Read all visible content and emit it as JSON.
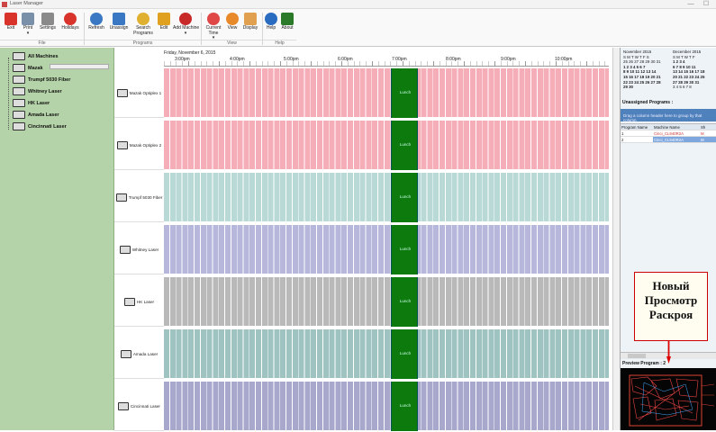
{
  "window": {
    "title": "Laser Manager",
    "controls": [
      "—",
      "☐"
    ]
  },
  "ribbon": {
    "buttons": [
      {
        "id": "exit",
        "label": "Exit",
        "icon": "exit-icon",
        "color": "#d9342b"
      },
      {
        "id": "print",
        "label": "Print",
        "sub": "▾",
        "icon": "printer-icon",
        "color": "#7a8fa8"
      },
      {
        "id": "settings",
        "label": "Settings",
        "icon": "tools-icon",
        "color": "#8a8a8a"
      },
      {
        "id": "holidays",
        "label": "Holidays",
        "icon": "holiday-icon",
        "color": "#d9342b"
      },
      {
        "id": "refresh",
        "label": "Refresh",
        "icon": "refresh-icon",
        "color": "#3a78c4"
      },
      {
        "id": "unassign",
        "label": "Unassign",
        "icon": "undo-arrow-icon",
        "color": "#3a78c4"
      },
      {
        "id": "search",
        "label": "Search Programs",
        "icon": "magnifier-icon",
        "color": "#e0b030"
      },
      {
        "id": "edit",
        "label": "Edit",
        "icon": "pencil-icon",
        "color": "#e0a020"
      },
      {
        "id": "add_machine",
        "label": "Add Machine",
        "sub": "▾",
        "icon": "gear-add-icon",
        "color": "#c82a2a"
      },
      {
        "id": "current_time",
        "label": "Current Time",
        "sub": "▾",
        "icon": "clock-icon",
        "color": "#e04848"
      },
      {
        "id": "view",
        "label": "View",
        "icon": "timer-icon",
        "color": "#e88a2a"
      },
      {
        "id": "display",
        "label": "Display",
        "icon": "tag-icon",
        "color": "#e0a050"
      },
      {
        "id": "help",
        "label": "Help",
        "icon": "help-icon",
        "color": "#2a6cc0"
      },
      {
        "id": "about",
        "label": "About",
        "icon": "back-arrow-icon",
        "color": "#2a7a2a"
      }
    ],
    "groups": [
      "File",
      "Programs",
      "View",
      "Help"
    ]
  },
  "tree": {
    "items": [
      "All Machines",
      "Mazak",
      "Trumpf 5030 Fiber",
      "Whitney Laser",
      "HK Laser",
      "Amada Laser",
      "Cincinnati Laser"
    ]
  },
  "schedule": {
    "date": "Friday, November 6, 2015",
    "times": [
      "3:00pm",
      "4:00pm",
      "5:00pm",
      "6:00pm",
      "7:00pm",
      "8:00pm",
      "9:00pm",
      "10:00pm"
    ],
    "lunch_label": "Lunch",
    "machines": [
      {
        "name": "Mazak Optiplex 1",
        "color": "#f5aeb8"
      },
      {
        "name": "Mazak Optiplex 2",
        "color": "#f5aeb8"
      },
      {
        "name": "Trumpf 5030 Fiber",
        "color": "#b8d9d6"
      },
      {
        "name": "Whitney Laser",
        "color": "#b7b7dc"
      },
      {
        "name": "HK Laser",
        "color": "#b9b9b9"
      },
      {
        "name": "Amada Laser",
        "color": "#9fc3c0"
      },
      {
        "name": "Cincinnati Laser",
        "color": "#a8a8cc"
      }
    ]
  },
  "calendar": {
    "months": [
      {
        "title": "November 2015",
        "head": "S M T W T F S",
        "rows": [
          "25 26 27 28 29 30 31",
          "1 2 3 4 5 6 7",
          "8 9 10 11 12 13 14",
          "15 16 17 18 19 20 21",
          "22 23 24 25 26 27 28",
          "29 30"
        ]
      },
      {
        "title": "December 2015",
        "head": "S M T W T F",
        "rows": [
          "1 2 3 4",
          "6 7 8 9 10 11",
          "13 14 15 16 17 18",
          "20 21 22 23 24 25",
          "27 28 29 30 31",
          "3 4 5 6 7 8"
        ]
      }
    ]
  },
  "unassigned": {
    "title": "Unassigned Programs :",
    "group_hint": "Drag a column header here to group by that column",
    "columns": [
      "Program Name",
      "Machine Name",
      "Sh"
    ],
    "rows": [
      {
        "program": "1",
        "machine": "Cinci_CL940R2A",
        "sh": "M"
      },
      {
        "program": "2",
        "machine": "Cinci_CL940R2A",
        "sh": "M"
      }
    ]
  },
  "preview": {
    "title": "Preview Program : 2"
  },
  "callout": {
    "line1": "Новый",
    "line2": "Просмотр",
    "line3": "Раскроя"
  }
}
